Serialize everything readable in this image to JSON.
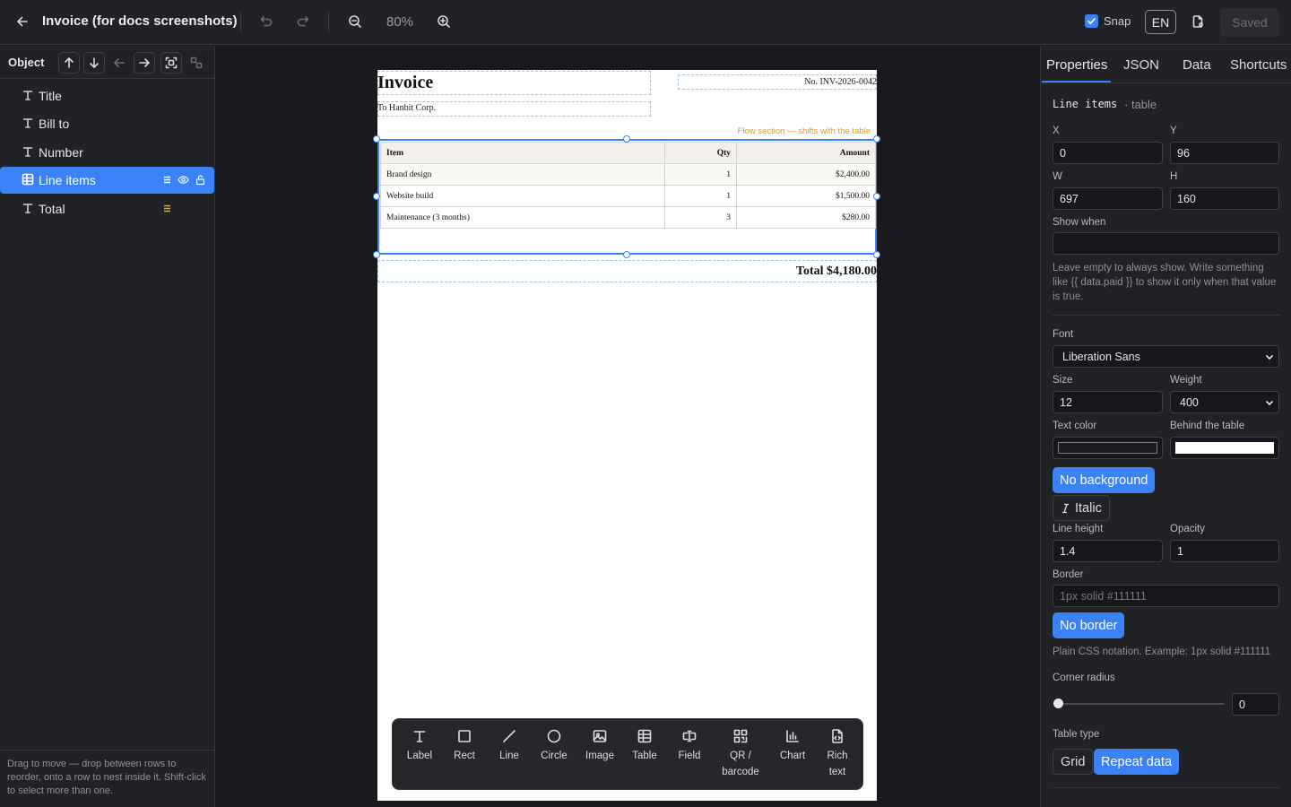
{
  "header": {
    "title": "Invoice (for docs screenshots)",
    "zoom": "80%",
    "snap_label": "Snap",
    "snap_checked": true,
    "lang": "EN",
    "saved_label": "Saved"
  },
  "left_panel": {
    "title": "Object",
    "layers": [
      {
        "name": "Title",
        "icon": "text-icon"
      },
      {
        "name": "Bill to",
        "icon": "text-icon"
      },
      {
        "name": "Number",
        "icon": "text-icon"
      },
      {
        "name": "Line items",
        "icon": "table-icon",
        "selected": true
      },
      {
        "name": "Total",
        "icon": "text-icon"
      }
    ],
    "hint": "Drag to move — drop between rows to reorder, onto a row to nest inside it. Shift-click to select more than one."
  },
  "invoice": {
    "title": "Invoice",
    "bill_to": "To Hanbit Corp.",
    "number": "No. INV-2026-0042",
    "flow_note": "Flow section — shifts with the table",
    "headers": [
      "Item",
      "Qty",
      "Amount"
    ],
    "rows": [
      [
        "Brand design",
        "1",
        "$2,400.00"
      ],
      [
        "Website build",
        "1",
        "$1,500.00"
      ],
      [
        "Maintenance (3 months)",
        "3",
        "$280.00"
      ]
    ],
    "total": "Total $4,180.00"
  },
  "toolbar": {
    "tools": [
      {
        "label": "Label",
        "icon": "text-icon"
      },
      {
        "label": "Rect",
        "icon": "square-icon"
      },
      {
        "label": "Line",
        "icon": "line-icon"
      },
      {
        "label": "Circle",
        "icon": "circle-icon"
      },
      {
        "label": "Image",
        "icon": "image-icon"
      },
      {
        "label": "Table",
        "icon": "table-icon"
      },
      {
        "label": "Field",
        "icon": "field-icon"
      },
      {
        "label": "QR / barcode",
        "label1": "QR /",
        "label2": "barcode",
        "icon": "qr-icon"
      },
      {
        "label": "Chart",
        "icon": "chart-icon"
      },
      {
        "label": "Rich text",
        "label1": "Rich",
        "label2": "text",
        "icon": "document-icon"
      }
    ]
  },
  "right_panel": {
    "tabs": [
      "Properties",
      "JSON",
      "Data",
      "Shortcuts"
    ],
    "active_tab": "Properties",
    "selection_name": "Line items",
    "selection_type": "· table",
    "fields": {
      "x_label": "X",
      "x": "0",
      "y_label": "Y",
      "y": "96",
      "w_label": "W",
      "w": "697",
      "h_label": "H",
      "h": "160",
      "show_when_label": "Show when",
      "show_when": "",
      "show_when_help": "Leave empty to always show. Write something like {{ data.paid }} to show it only when that value is true.",
      "font_label": "Font",
      "font": "Liberation Sans",
      "size_label": "Size",
      "size": "12",
      "weight_label": "Weight",
      "weight": "400",
      "text_color_label": "Text color",
      "behind_label": "Behind the table",
      "no_background": "No background",
      "italic": "Italic",
      "line_height_label": "Line height",
      "line_height": "1.4",
      "opacity_label": "Opacity",
      "opacity": "1",
      "border_label": "Border",
      "border_placeholder": "1px solid #111111",
      "no_border": "No border",
      "border_help": "Plain CSS notation. Example: 1px solid #111111",
      "corner_radius_label": "Corner radius",
      "corner_radius": "0",
      "table_type_label": "Table type",
      "table_types": [
        "Grid",
        "Repeat data"
      ],
      "table_type_selected": "Repeat data"
    }
  },
  "colors": {
    "accent": "#3b82f6",
    "warning_note": "#d39a3d",
    "layer_drag_handle": "#d8a838",
    "text_color_swatch": "#1b1b1f",
    "behind_swatch": "#ffffff"
  }
}
